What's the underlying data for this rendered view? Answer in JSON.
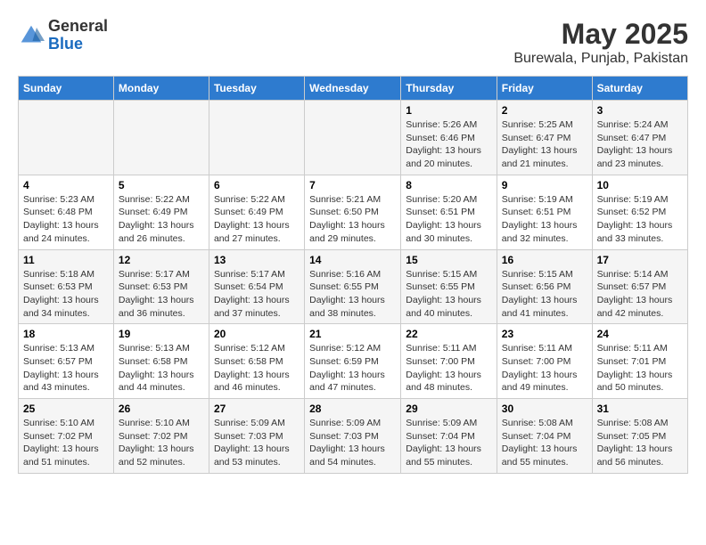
{
  "header": {
    "logo_general": "General",
    "logo_blue": "Blue",
    "title": "May 2025",
    "subtitle": "Burewala, Punjab, Pakistan"
  },
  "days_of_week": [
    "Sunday",
    "Monday",
    "Tuesday",
    "Wednesday",
    "Thursday",
    "Friday",
    "Saturday"
  ],
  "weeks": [
    [
      {
        "day": "",
        "info": ""
      },
      {
        "day": "",
        "info": ""
      },
      {
        "day": "",
        "info": ""
      },
      {
        "day": "",
        "info": ""
      },
      {
        "day": "1",
        "info": "Sunrise: 5:26 AM\nSunset: 6:46 PM\nDaylight: 13 hours\nand 20 minutes."
      },
      {
        "day": "2",
        "info": "Sunrise: 5:25 AM\nSunset: 6:47 PM\nDaylight: 13 hours\nand 21 minutes."
      },
      {
        "day": "3",
        "info": "Sunrise: 5:24 AM\nSunset: 6:47 PM\nDaylight: 13 hours\nand 23 minutes."
      }
    ],
    [
      {
        "day": "4",
        "info": "Sunrise: 5:23 AM\nSunset: 6:48 PM\nDaylight: 13 hours\nand 24 minutes."
      },
      {
        "day": "5",
        "info": "Sunrise: 5:22 AM\nSunset: 6:49 PM\nDaylight: 13 hours\nand 26 minutes."
      },
      {
        "day": "6",
        "info": "Sunrise: 5:22 AM\nSunset: 6:49 PM\nDaylight: 13 hours\nand 27 minutes."
      },
      {
        "day": "7",
        "info": "Sunrise: 5:21 AM\nSunset: 6:50 PM\nDaylight: 13 hours\nand 29 minutes."
      },
      {
        "day": "8",
        "info": "Sunrise: 5:20 AM\nSunset: 6:51 PM\nDaylight: 13 hours\nand 30 minutes."
      },
      {
        "day": "9",
        "info": "Sunrise: 5:19 AM\nSunset: 6:51 PM\nDaylight: 13 hours\nand 32 minutes."
      },
      {
        "day": "10",
        "info": "Sunrise: 5:19 AM\nSunset: 6:52 PM\nDaylight: 13 hours\nand 33 minutes."
      }
    ],
    [
      {
        "day": "11",
        "info": "Sunrise: 5:18 AM\nSunset: 6:53 PM\nDaylight: 13 hours\nand 34 minutes."
      },
      {
        "day": "12",
        "info": "Sunrise: 5:17 AM\nSunset: 6:53 PM\nDaylight: 13 hours\nand 36 minutes."
      },
      {
        "day": "13",
        "info": "Sunrise: 5:17 AM\nSunset: 6:54 PM\nDaylight: 13 hours\nand 37 minutes."
      },
      {
        "day": "14",
        "info": "Sunrise: 5:16 AM\nSunset: 6:55 PM\nDaylight: 13 hours\nand 38 minutes."
      },
      {
        "day": "15",
        "info": "Sunrise: 5:15 AM\nSunset: 6:55 PM\nDaylight: 13 hours\nand 40 minutes."
      },
      {
        "day": "16",
        "info": "Sunrise: 5:15 AM\nSunset: 6:56 PM\nDaylight: 13 hours\nand 41 minutes."
      },
      {
        "day": "17",
        "info": "Sunrise: 5:14 AM\nSunset: 6:57 PM\nDaylight: 13 hours\nand 42 minutes."
      }
    ],
    [
      {
        "day": "18",
        "info": "Sunrise: 5:13 AM\nSunset: 6:57 PM\nDaylight: 13 hours\nand 43 minutes."
      },
      {
        "day": "19",
        "info": "Sunrise: 5:13 AM\nSunset: 6:58 PM\nDaylight: 13 hours\nand 44 minutes."
      },
      {
        "day": "20",
        "info": "Sunrise: 5:12 AM\nSunset: 6:58 PM\nDaylight: 13 hours\nand 46 minutes."
      },
      {
        "day": "21",
        "info": "Sunrise: 5:12 AM\nSunset: 6:59 PM\nDaylight: 13 hours\nand 47 minutes."
      },
      {
        "day": "22",
        "info": "Sunrise: 5:11 AM\nSunset: 7:00 PM\nDaylight: 13 hours\nand 48 minutes."
      },
      {
        "day": "23",
        "info": "Sunrise: 5:11 AM\nSunset: 7:00 PM\nDaylight: 13 hours\nand 49 minutes."
      },
      {
        "day": "24",
        "info": "Sunrise: 5:11 AM\nSunset: 7:01 PM\nDaylight: 13 hours\nand 50 minutes."
      }
    ],
    [
      {
        "day": "25",
        "info": "Sunrise: 5:10 AM\nSunset: 7:02 PM\nDaylight: 13 hours\nand 51 minutes."
      },
      {
        "day": "26",
        "info": "Sunrise: 5:10 AM\nSunset: 7:02 PM\nDaylight: 13 hours\nand 52 minutes."
      },
      {
        "day": "27",
        "info": "Sunrise: 5:09 AM\nSunset: 7:03 PM\nDaylight: 13 hours\nand 53 minutes."
      },
      {
        "day": "28",
        "info": "Sunrise: 5:09 AM\nSunset: 7:03 PM\nDaylight: 13 hours\nand 54 minutes."
      },
      {
        "day": "29",
        "info": "Sunrise: 5:09 AM\nSunset: 7:04 PM\nDaylight: 13 hours\nand 55 minutes."
      },
      {
        "day": "30",
        "info": "Sunrise: 5:08 AM\nSunset: 7:04 PM\nDaylight: 13 hours\nand 55 minutes."
      },
      {
        "day": "31",
        "info": "Sunrise: 5:08 AM\nSunset: 7:05 PM\nDaylight: 13 hours\nand 56 minutes."
      }
    ]
  ]
}
